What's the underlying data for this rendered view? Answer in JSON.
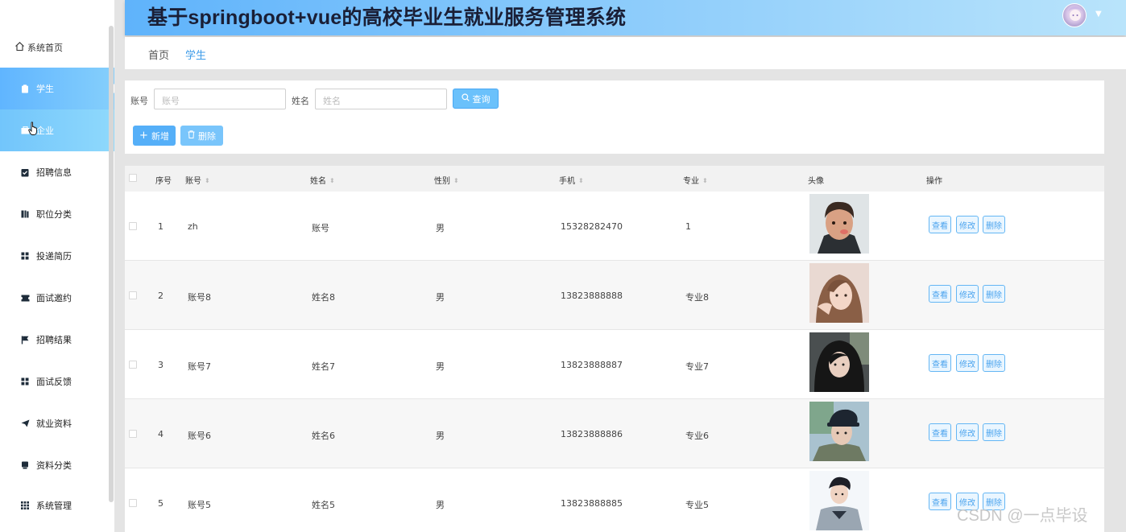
{
  "app": {
    "title": "基于springboot+vue的高校毕业生就业服务管理系统"
  },
  "sidebar": {
    "home_label": "系统首页",
    "items": [
      {
        "label": "学生",
        "icon": "clipboard-icon",
        "state": "active"
      },
      {
        "label": "企业",
        "icon": "building-icon",
        "state": "hover"
      },
      {
        "label": "招聘信息",
        "icon": "clipboard-check-icon",
        "state": "normal"
      },
      {
        "label": "职位分类",
        "icon": "book-icon",
        "state": "normal"
      },
      {
        "label": "投递简历",
        "icon": "grid-icon",
        "state": "normal"
      },
      {
        "label": "面试邀约",
        "icon": "ticket-icon",
        "state": "normal"
      },
      {
        "label": "招聘结果",
        "icon": "flag-icon",
        "state": "normal"
      },
      {
        "label": "面试反馈",
        "icon": "grid-icon",
        "state": "normal"
      },
      {
        "label": "就业资料",
        "icon": "send-icon",
        "state": "normal"
      },
      {
        "label": "资料分类",
        "icon": "tablet-icon",
        "state": "normal"
      },
      {
        "label": "系统管理",
        "icon": "apps-icon",
        "state": "normal"
      }
    ]
  },
  "tabs": [
    {
      "label": "首页",
      "active": false
    },
    {
      "label": "学生",
      "active": true
    }
  ],
  "search": {
    "account_label": "账号",
    "account_placeholder": "账号",
    "name_label": "姓名",
    "name_placeholder": "姓名",
    "search_button": "查询",
    "add_button": "新增",
    "delete_button": "删除"
  },
  "table": {
    "headers": [
      "序号",
      "账号",
      "姓名",
      "性别",
      "手机",
      "专业",
      "头像",
      "操作"
    ],
    "rows": [
      {
        "index": "1",
        "account": "zh",
        "name": "账号",
        "gender": "男",
        "phone": "15328282470",
        "major": "1"
      },
      {
        "index": "2",
        "account": "账号8",
        "name": "姓名8",
        "gender": "男",
        "phone": "13823888888",
        "major": "专业8"
      },
      {
        "index": "3",
        "account": "账号7",
        "name": "姓名7",
        "gender": "男",
        "phone": "13823888887",
        "major": "专业7"
      },
      {
        "index": "4",
        "account": "账号6",
        "name": "姓名6",
        "gender": "男",
        "phone": "13823888886",
        "major": "专业6"
      },
      {
        "index": "5",
        "account": "账号5",
        "name": "姓名5",
        "gender": "男",
        "phone": "13823888885",
        "major": "专业5"
      }
    ],
    "actions": {
      "view": "查看",
      "edit": "修改",
      "delete": "删除"
    }
  },
  "watermark": "CSDN @一点毕设",
  "colors": {
    "accent": "#60b5ff",
    "header_start": "#5fb3fb",
    "header_end": "#b9e4fb",
    "tab_active": "#3b9ae8",
    "background": "#e4e4e4"
  }
}
